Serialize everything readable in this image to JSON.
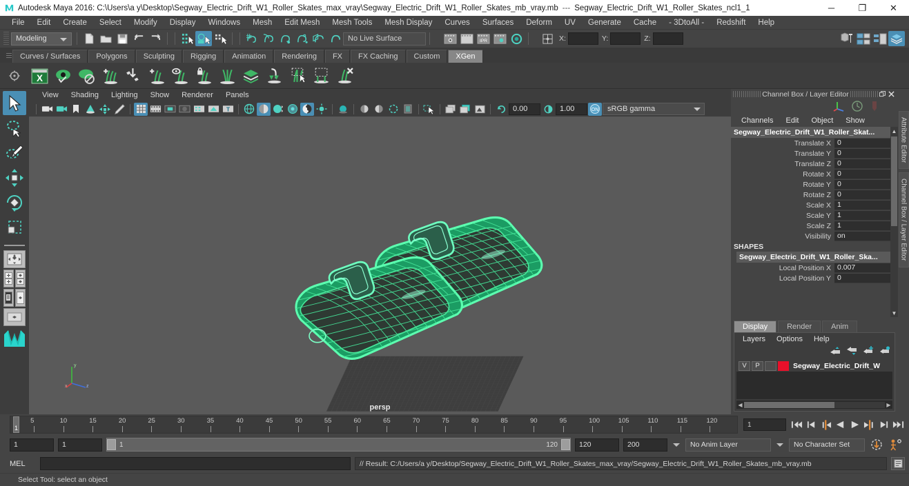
{
  "window": {
    "title": "Autodesk Maya 2016: C:\\Users\\a y\\Desktop\\Segway_Electric_Drift_W1_Roller_Skates_max_vray\\Segway_Electric_Drift_W1_Roller_Skates_mb_vray.mb",
    "separator": "---",
    "subtitle": "Segway_Electric_Drift_W1_Roller_Skates_ncl1_1",
    "minimize": "─",
    "maximize": "❐",
    "close": "✕",
    "app_icon": "maya-icon"
  },
  "menubar": {
    "items": [
      {
        "label": "File"
      },
      {
        "label": "Edit"
      },
      {
        "label": "Create"
      },
      {
        "label": "Select"
      },
      {
        "label": "Modify"
      },
      {
        "label": "Display"
      },
      {
        "label": "Windows"
      },
      {
        "label": "Mesh"
      },
      {
        "label": "Edit Mesh"
      },
      {
        "label": "Mesh Tools"
      },
      {
        "label": "Mesh Display"
      },
      {
        "label": "Curves"
      },
      {
        "label": "Surfaces"
      },
      {
        "label": "Deform"
      },
      {
        "label": "UV"
      },
      {
        "label": "Generate"
      },
      {
        "label": "Cache"
      },
      {
        "label": "- 3DtoAll -"
      },
      {
        "label": "Redshift"
      },
      {
        "label": "Help"
      }
    ]
  },
  "statusline": {
    "mode": "Modeling",
    "live_surface": "No Live Surface",
    "axis_x_label": "X:",
    "axis_y_label": "Y:",
    "axis_z_label": "Z:",
    "axis_x_value": "",
    "axis_y_value": "",
    "axis_z_value": "",
    "accent": "#4a8fb5"
  },
  "shelf": {
    "tabs": [
      {
        "label": "Curves / Surfaces",
        "active": false
      },
      {
        "label": "Polygons",
        "active": false
      },
      {
        "label": "Sculpting",
        "active": false
      },
      {
        "label": "Rigging",
        "active": false
      },
      {
        "label": "Animation",
        "active": false
      },
      {
        "label": "Rendering",
        "active": false
      },
      {
        "label": "FX",
        "active": false
      },
      {
        "label": "FX Caching",
        "active": false
      },
      {
        "label": "Custom",
        "active": false
      },
      {
        "label": "XGen",
        "active": true
      }
    ],
    "icons": [
      "xgen-editor-icon",
      "preview-eye-icon",
      "disable-preview-icon",
      "add-description-icon",
      "import-collection-icon",
      "add-guide-icon",
      "guide-preview-icon",
      "lock-guide-icon",
      "mirror-guides-icon",
      "layers-icon",
      "convert-primitive-icon",
      "select-guide-icon",
      "region-mask-icon",
      "delete-guide-icon"
    ]
  },
  "toolbox": {
    "tools": [
      {
        "name": "select-tool",
        "active": true
      },
      {
        "name": "lasso-select-tool",
        "active": false
      },
      {
        "name": "paint-select-tool",
        "active": false
      },
      {
        "name": "move-tool",
        "active": false
      },
      {
        "name": "rotate-tool",
        "active": false
      },
      {
        "name": "scale-tool",
        "active": false
      }
    ],
    "layouts": [
      "single-pane-layout",
      "four-pane-layout",
      "persp-outliner-layout",
      "persp-graph-layout",
      "hypershade-layout"
    ]
  },
  "viewport": {
    "menus": [
      {
        "label": "View"
      },
      {
        "label": "Shading"
      },
      {
        "label": "Lighting"
      },
      {
        "label": "Show"
      },
      {
        "label": "Renderer"
      },
      {
        "label": "Panels"
      }
    ],
    "exposure": "0.00",
    "gamma": "1.00",
    "color_profile": "sRGB gamma",
    "camera_label": "persp",
    "background_color": "#5a5a5a",
    "wireframe_color": "#3dea8d",
    "axis_labels": {
      "x": "x",
      "y": "y",
      "z": "z"
    }
  },
  "channel_box": {
    "panel_title": "Channel Box / Layer Editor",
    "menus": [
      {
        "label": "Channels"
      },
      {
        "label": "Edit"
      },
      {
        "label": "Object"
      },
      {
        "label": "Show"
      }
    ],
    "object_name": "Segway_Electric_Drift_W1_Roller_Skat...",
    "attributes": [
      {
        "label": "Translate X",
        "value": "0"
      },
      {
        "label": "Translate Y",
        "value": "0"
      },
      {
        "label": "Translate Z",
        "value": "0"
      },
      {
        "label": "Rotate X",
        "value": "0"
      },
      {
        "label": "Rotate Y",
        "value": "0"
      },
      {
        "label": "Rotate Z",
        "value": "0"
      },
      {
        "label": "Scale X",
        "value": "1"
      },
      {
        "label": "Scale Y",
        "value": "1"
      },
      {
        "label": "Scale Z",
        "value": "1"
      },
      {
        "label": "Visibility",
        "value": "on"
      }
    ],
    "shapes_header": "SHAPES",
    "shape_name": "Segway_Electric_Drift_W1_Roller_Ska...",
    "shape_attributes": [
      {
        "label": "Local Position X",
        "value": "0.007"
      },
      {
        "label": "Local Position Y",
        "value": "0"
      }
    ]
  },
  "layer_editor": {
    "tabs": [
      {
        "label": "Display",
        "active": true
      },
      {
        "label": "Render",
        "active": false
      },
      {
        "label": "Anim",
        "active": false
      }
    ],
    "menus": [
      {
        "label": "Layers"
      },
      {
        "label": "Options"
      },
      {
        "label": "Help"
      }
    ],
    "buttons": [
      "move-layer-up-icon",
      "move-layer-down-icon",
      "new-layer-icon",
      "new-layer-from-selected-icon"
    ],
    "layers": [
      {
        "visible": "V",
        "playback": "P",
        "state": "",
        "color": "#e8102a",
        "name": "Segway_Electric_Drift_W"
      }
    ]
  },
  "vertical_tabs": [
    {
      "label": "Attribute Editor"
    },
    {
      "label": "Channel Box / Layer Editor"
    }
  ],
  "timeline": {
    "ticks": [
      5,
      10,
      15,
      20,
      25,
      30,
      35,
      40,
      45,
      50,
      55,
      60,
      65,
      70,
      75,
      80,
      85,
      90,
      95,
      100,
      105,
      110,
      115,
      120
    ],
    "start": 1,
    "end": 120,
    "current_frame": "1",
    "current_frame_field": "1",
    "playback_buttons": [
      "go-to-start-icon",
      "step-back-keyframe-icon",
      "step-back-frame-icon",
      "play-backwards-icon",
      "play-forwards-icon",
      "step-forward-frame-icon",
      "step-forward-keyframe-icon",
      "go-to-end-icon"
    ]
  },
  "range_slider": {
    "anim_start": "1",
    "range_start": "1",
    "slider_start_label": "1",
    "slider_end_label": "120",
    "range_end": "120",
    "anim_end": "200",
    "anim_layer": "No Anim Layer",
    "character_set": "No Character Set",
    "auto_key_icon": "auto-keyframe-icon",
    "anim_prefs_icon": "animation-preferences-icon"
  },
  "command_line": {
    "language_label": "MEL",
    "input_value": "",
    "result": "// Result: C:/Users/a y/Desktop/Segway_Electric_Drift_W1_Roller_Skates_max_vray/Segway_Electric_Drift_W1_Roller_Skates_mb_vray.mb",
    "script_editor_icon": "script-editor-icon"
  },
  "help_line": {
    "text": "Select Tool: select an object"
  }
}
